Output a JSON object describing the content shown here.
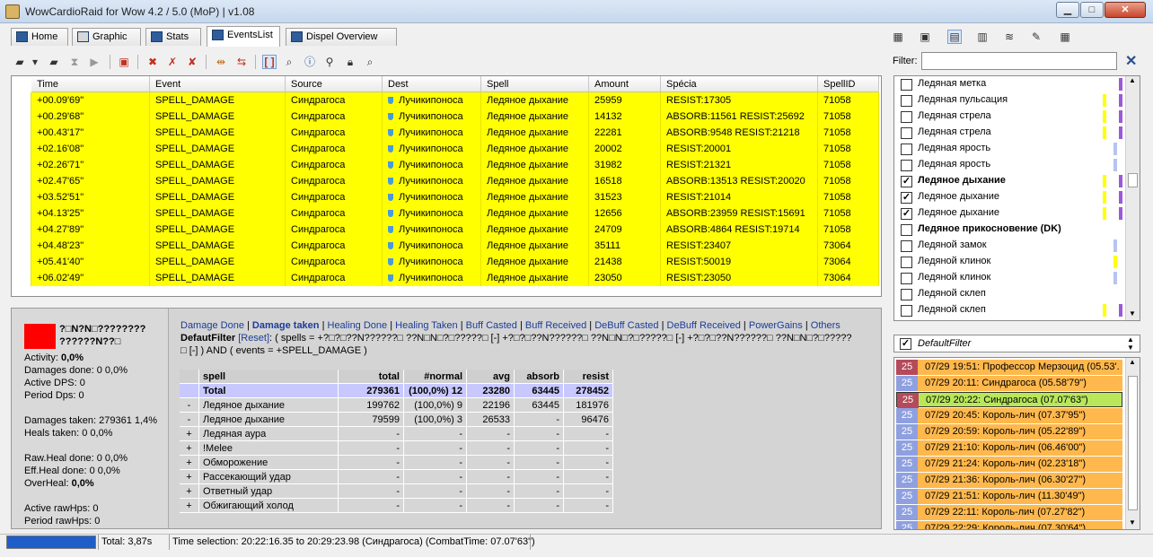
{
  "window": {
    "title": "WowCardioRaid for Wow 4.2 / 5.0 (MoP) | v1.08"
  },
  "tabs": [
    {
      "label": "Home"
    },
    {
      "label": "Graphic"
    },
    {
      "label": "Stats"
    },
    {
      "label": "EventsList"
    },
    {
      "label": "Dispel Overview"
    }
  ],
  "grid": {
    "columns": [
      "Time",
      "Event",
      "Source",
      "Dest",
      "Spell",
      "Amount",
      "Spécia",
      "SpellID"
    ],
    "rows": [
      [
        "+00.09'69\"",
        "SPELL_DAMAGE",
        "Синдрагоса",
        "Лучикипоноса",
        "Ледяное дыхание",
        "25959",
        "RESIST:17305",
        "71058"
      ],
      [
        "+00.29'68\"",
        "SPELL_DAMAGE",
        "Синдрагоса",
        "Лучикипоноса",
        "Ледяное дыхание",
        "14132",
        "ABSORB:11561 RESIST:25692",
        "71058"
      ],
      [
        "+00.43'17\"",
        "SPELL_DAMAGE",
        "Синдрагоса",
        "Лучикипоноса",
        "Ледяное дыхание",
        "22281",
        "ABSORB:9548 RESIST:21218",
        "71058"
      ],
      [
        "+02.16'08\"",
        "SPELL_DAMAGE",
        "Синдрагоса",
        "Лучикипоноса",
        "Ледяное дыхание",
        "20002",
        "RESIST:20001",
        "71058"
      ],
      [
        "+02.26'71\"",
        "SPELL_DAMAGE",
        "Синдрагоса",
        "Лучикипоноса",
        "Ледяное дыхание",
        "31982",
        "RESIST:21321",
        "71058"
      ],
      [
        "+02.47'65\"",
        "SPELL_DAMAGE",
        "Синдрагоса",
        "Лучикипоноса",
        "Ледяное дыхание",
        "16518",
        "ABSORB:13513 RESIST:20020",
        "71058"
      ],
      [
        "+03.52'51\"",
        "SPELL_DAMAGE",
        "Синдрагоса",
        "Лучикипоноса",
        "Ледяное дыхание",
        "31523",
        "RESIST:21014",
        "71058"
      ],
      [
        "+04.13'25\"",
        "SPELL_DAMAGE",
        "Синдрагоса",
        "Лучикипоноса",
        "Ледяное дыхание",
        "12656",
        "ABSORB:23959 RESIST:15691",
        "71058"
      ],
      [
        "+04.27'89\"",
        "SPELL_DAMAGE",
        "Синдрагоса",
        "Лучикипоноса",
        "Ледяное дыхание",
        "24709",
        "ABSORB:4864 RESIST:19714",
        "71058"
      ],
      [
        "+04.48'23\"",
        "SPELL_DAMAGE",
        "Синдрагоса",
        "Лучикипоноса",
        "Ледяное дыхание",
        "35111",
        "RESIST:23407",
        "73064"
      ],
      [
        "+05.41'40\"",
        "SPELL_DAMAGE",
        "Синдрагоса",
        "Лучикипоноса",
        "Ледяное дыхание",
        "21438",
        "RESIST:50019",
        "73064"
      ],
      [
        "+06.02'49\"",
        "SPELL_DAMAGE",
        "Синдрагоса",
        "Лучикипоноса",
        "Ледяное дыхание",
        "23050",
        "RESIST:23050",
        "73064"
      ]
    ]
  },
  "filter": {
    "label": "Filter:",
    "value": ""
  },
  "spell_list": [
    {
      "label": "Ледяная метка",
      "checked": false,
      "bold": false,
      "bars": [
        "#9b59d8"
      ]
    },
    {
      "label": "Ледяная пульсация",
      "checked": false,
      "bold": false,
      "bars": [
        "#ffff00",
        "#9b59d8"
      ]
    },
    {
      "label": "Ледяная стрела",
      "checked": false,
      "bold": false,
      "bars": [
        "#ffff00",
        "#9b59d8"
      ]
    },
    {
      "label": "Ледяная стрела",
      "checked": false,
      "bold": false,
      "bars": [
        "#ffff00",
        "#9b59d8"
      ]
    },
    {
      "label": "Ледяная ярость",
      "checked": false,
      "bold": false,
      "bars": [
        "#b8c4f0"
      ]
    },
    {
      "label": "Ледяная ярость",
      "checked": false,
      "bold": false,
      "bars": [
        "#b8c4f0"
      ]
    },
    {
      "label": "Ледяное дыхание",
      "checked": true,
      "bold": true,
      "bars": [
        "#ffff00",
        "#9b59d8"
      ]
    },
    {
      "label": "Ледяное дыхание",
      "checked": true,
      "bold": false,
      "bars": [
        "#ffff00",
        "#9b59d8"
      ]
    },
    {
      "label": "Ледяное дыхание",
      "checked": true,
      "bold": false,
      "bars": [
        "#ffff00",
        "#9b59d8"
      ]
    },
    {
      "label": "Ледяное прикосновение (DK)",
      "checked": false,
      "bold": true,
      "bars": []
    },
    {
      "label": "Ледяной замок",
      "checked": false,
      "bold": false,
      "bars": [
        "#b8c4f0"
      ]
    },
    {
      "label": "Ледяной клинок",
      "checked": false,
      "bold": false,
      "bars": [
        "#ffff00"
      ]
    },
    {
      "label": "Ледяной клинок",
      "checked": false,
      "bold": false,
      "bars": [
        "#b8c4f0"
      ]
    },
    {
      "label": "Ледяной склеп",
      "checked": false,
      "bold": false,
      "bars": []
    },
    {
      "label": "Ледяной склеп",
      "checked": false,
      "bold": false,
      "bars": [
        "#ffff00",
        "#9b59d8"
      ]
    }
  ],
  "default_filter": {
    "label": "DefaultFilter",
    "checked": true
  },
  "fights": [
    {
      "num": "25",
      "text": "07/29  19:51: Профессор Мерзоцид (05.53'...",
      "style": "red"
    },
    {
      "num": "25",
      "text": "07/29  20:11: Синдрагоса (05.58'79\")",
      "style": "normal"
    },
    {
      "num": "25",
      "text": "07/29  20:22: Синдрагоса (07.07'63\")",
      "style": "selected"
    },
    {
      "num": "25",
      "text": "07/29  20:45: Король-лич (07.37'95\")",
      "style": "normal"
    },
    {
      "num": "25",
      "text": "07/29  20:59: Король-лич (05.22'89\")",
      "style": "normal"
    },
    {
      "num": "25",
      "text": "07/29  21:10: Король-лич (06.46'00\")",
      "style": "normal"
    },
    {
      "num": "25",
      "text": "07/29  21:24: Король-лич (02.23'18\")",
      "style": "normal"
    },
    {
      "num": "25",
      "text": "07/29  21:36: Король-лич (06.30'27\")",
      "style": "normal"
    },
    {
      "num": "25",
      "text": "07/29  21:51: Король-лич (11.30'49\")",
      "style": "normal"
    },
    {
      "num": "25",
      "text": "07/29  22:11: Король-лич (07.27'82\")",
      "style": "normal"
    },
    {
      "num": "25",
      "text": "07/29  22:29: Король-лич (07.30'64\")",
      "style": "normal"
    }
  ],
  "player": {
    "name_line1": "?□N?N□????????",
    "name_line2": "??????N??□",
    "color": "#ff0000"
  },
  "stats": [
    {
      "label": "Activity:",
      "value": "0,0%",
      "bold": true
    },
    {
      "label": "Damages done:",
      "value": "0 0,0%",
      "bold": false
    },
    {
      "label": "Active DPS:",
      "value": "0",
      "bold": false
    },
    {
      "label": "Period Dps:",
      "value": "0",
      "bold": false
    },
    {
      "label": "",
      "value": "",
      "bold": false
    },
    {
      "label": "Damages taken:",
      "value": "279361 1,4%",
      "bold": false
    },
    {
      "label": "Heals taken:",
      "value": "0 0,0%",
      "bold": false
    },
    {
      "label": "",
      "value": "",
      "bold": false
    },
    {
      "label": "Raw.Heal done:",
      "value": "0 0,0%",
      "bold": false
    },
    {
      "label": "Eff.Heal done:",
      "value": "0 0,0%",
      "bold": false
    },
    {
      "label": "OverHeal:",
      "value": "0,0%",
      "bold": true
    },
    {
      "label": "",
      "value": "",
      "bold": false
    },
    {
      "label": "Active rawHps:",
      "value": "0",
      "bold": false
    },
    {
      "label": "Period rawHps:",
      "value": "0",
      "bold": false
    }
  ],
  "detail_links": [
    "Damage Done",
    "Damage taken",
    "Healing Done",
    "Healing Taken",
    "Buff Casted",
    "Buff Received",
    "DeBuff Casted",
    "DeBuff Received",
    "PowerGains",
    "Others"
  ],
  "filter_text": {
    "name": "DefautFilter",
    "reset": "[Reset]",
    "line1": ": ( spells = +?□?□??N??????□ ??N□N□?□?????□ [-] +?□?□??N??????□ ??N□N□?□?????□ [-] +?□?□??N??????□ ??N□N□?□?????",
    "line2": "□ [-] ) AND ( events = +SPELL_DAMAGE )"
  },
  "detail_table": {
    "columns": [
      "spell",
      "total",
      "#normal",
      "avg",
      "absorb",
      "resist"
    ],
    "rows": [
      {
        "exp": "",
        "cells": [
          "Total",
          "279361",
          "(100,0%)  12",
          "23280",
          "63445",
          "278452"
        ],
        "style": "total"
      },
      {
        "exp": "-",
        "cells": [
          "Ледяное дыхание",
          "199762",
          "(100,0%)  9",
          "22196",
          "63445",
          "181976"
        ],
        "style": ""
      },
      {
        "exp": "-",
        "cells": [
          "Ледяное дыхание",
          "79599",
          "(100,0%)  3",
          "26533",
          "-",
          "96476"
        ],
        "style": ""
      },
      {
        "exp": "+",
        "cells": [
          "Ледяная аура",
          "-",
          "-",
          "-",
          "-",
          "-"
        ],
        "style": ""
      },
      {
        "exp": "+",
        "cells": [
          "!Melee",
          "-",
          "-",
          "-",
          "-",
          "-"
        ],
        "style": ""
      },
      {
        "exp": "+",
        "cells": [
          "Обморожение",
          "-",
          "-",
          "-",
          "-",
          "-"
        ],
        "style": ""
      },
      {
        "exp": "+",
        "cells": [
          "Рассекающий удар",
          "-",
          "-",
          "-",
          "-",
          "-"
        ],
        "style": ""
      },
      {
        "exp": "+",
        "cells": [
          "Ответный удар",
          "-",
          "-",
          "-",
          "-",
          "-"
        ],
        "style": ""
      },
      {
        "exp": "+",
        "cells": [
          "Обжигающий холод",
          "-",
          "-",
          "-",
          "-",
          "-"
        ],
        "style": ""
      }
    ]
  },
  "status": {
    "total": "Total: 3,87s",
    "selection": "Time selection: 20:22:16.35 to 20:29:23.98 (Синдрагоса)  (CombatTime: 07.07'63\")"
  }
}
